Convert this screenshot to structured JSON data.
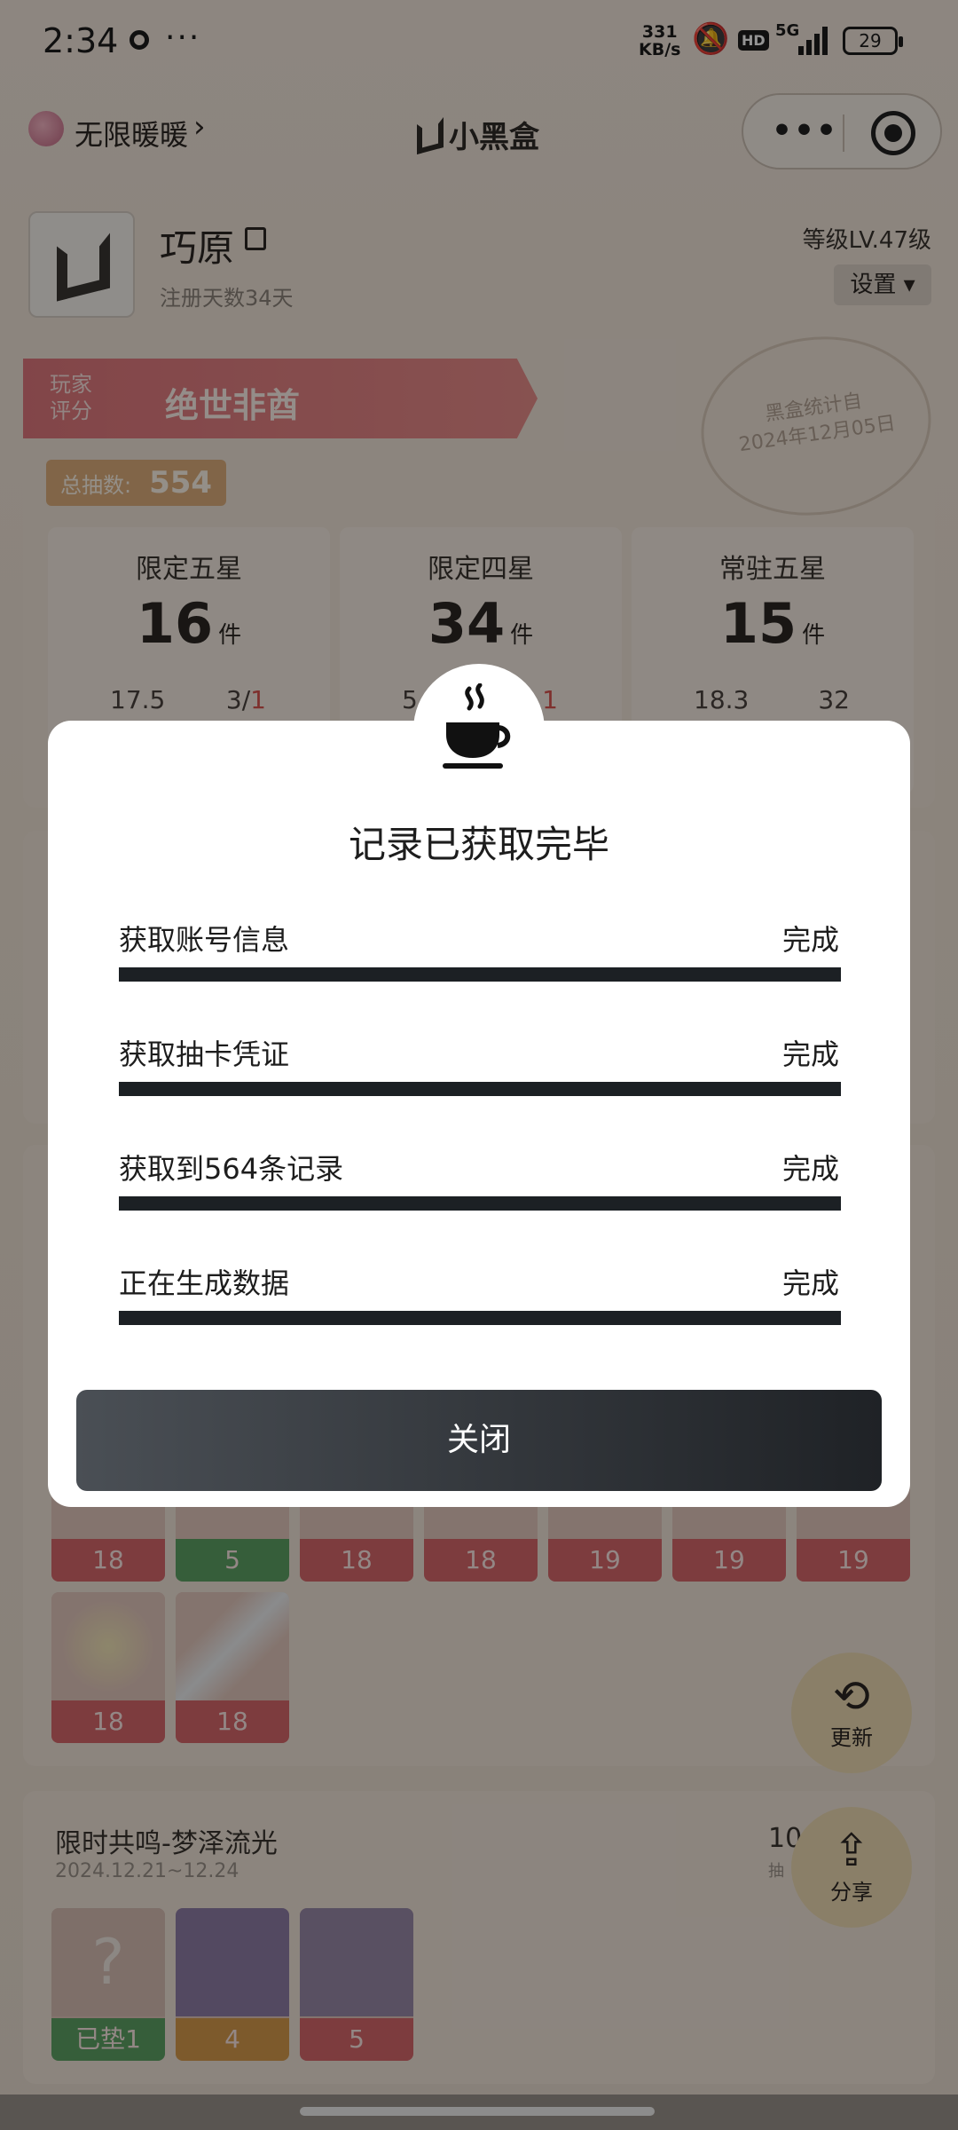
{
  "status_bar": {
    "time": "2:34",
    "more": "···",
    "net_speed_value": "331",
    "net_speed_unit": "KB/s",
    "hd": "HD",
    "signal": "5G",
    "battery": "29"
  },
  "topbar": {
    "user_name": "无限暖暖",
    "chevron": "›",
    "brand": "小黑盒",
    "capsule_more": "•••"
  },
  "profile": {
    "name": "巧原",
    "registered": "注册天数34天",
    "level": "等级LV.47级",
    "settings": "设置 ▾"
  },
  "score": {
    "label_line1": "玩家",
    "label_line2": "评分",
    "value": "绝世非酋",
    "stamp_line1": "黑盒统计自",
    "stamp_line2": "2024年12月05日"
  },
  "total": {
    "label": "总抽数:",
    "value": "554"
  },
  "stats": [
    {
      "title": "限定五星",
      "count": "16",
      "unit": "件",
      "left": "17.5",
      "right_a": "3/",
      "right_b": "1"
    },
    {
      "title": "限定四星",
      "count": "34",
      "unit": "件",
      "left": "5",
      "right_a": "",
      "right_b": "1"
    },
    {
      "title": "常驻五星",
      "count": "15",
      "unit": "件",
      "left": "18.3",
      "right_a": "32",
      "right_b": ""
    }
  ],
  "tiles_row1": [
    "18",
    "5",
    "18",
    "18",
    "19",
    "19",
    "19"
  ],
  "tiles_row2": [
    "18",
    "18"
  ],
  "banner": {
    "title": "限时共鸣-梦泽流光",
    "date": "2024.12.21~12.24",
    "right_value": "10",
    "right_label": "抽",
    "tiles": [
      "已垫1",
      "4",
      "5"
    ]
  },
  "fabs": {
    "refresh": "更新",
    "share": "分享"
  },
  "dialog": {
    "title": "记录已获取完毕",
    "icon": "coffee-cup-icon",
    "steps": [
      {
        "label": "获取账号信息",
        "status": "完成",
        "progress": 1.0
      },
      {
        "label": "获取抽卡凭证",
        "status": "完成",
        "progress": 1.0
      },
      {
        "label": "获取到564条记录",
        "status": "完成",
        "progress": 1.0
      },
      {
        "label": "正在生成数据",
        "status": "完成",
        "progress": 1.0
      }
    ],
    "close_label": "关闭"
  },
  "colors": {
    "accent_dark": "#1c2024",
    "ribbon": "#e1787e",
    "tile_red": "#d8686c",
    "tile_green": "#5da364"
  }
}
